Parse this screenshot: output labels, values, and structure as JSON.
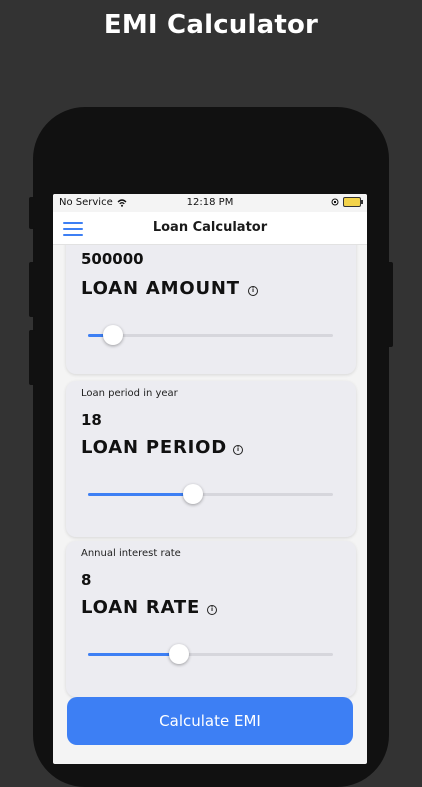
{
  "promo": {
    "title": "EMI Calculator"
  },
  "status_bar": {
    "carrier": "No Service",
    "time": "12:18 PM"
  },
  "nav": {
    "title": "Loan Calculator"
  },
  "cards": [
    {
      "caption": "",
      "value": "500000",
      "label": "LOAN AMOUNT",
      "slider_fraction": 0.1
    },
    {
      "caption": "Loan period in year",
      "value": "18",
      "label": "LOAN PERIOD",
      "slider_fraction": 0.43
    },
    {
      "caption": "Annual interest rate",
      "value": "8",
      "label": "LOAN RATE",
      "slider_fraction": 0.37
    }
  ],
  "calculate_button": {
    "label": "Calculate EMI"
  },
  "colors": {
    "accent": "#3d7ff4",
    "background": "#333333",
    "card": "#ececf1"
  },
  "icons": {
    "menu": "hamburger-icon",
    "info": "info-icon",
    "wifi": "wifi-icon",
    "battery": "battery-icon"
  }
}
